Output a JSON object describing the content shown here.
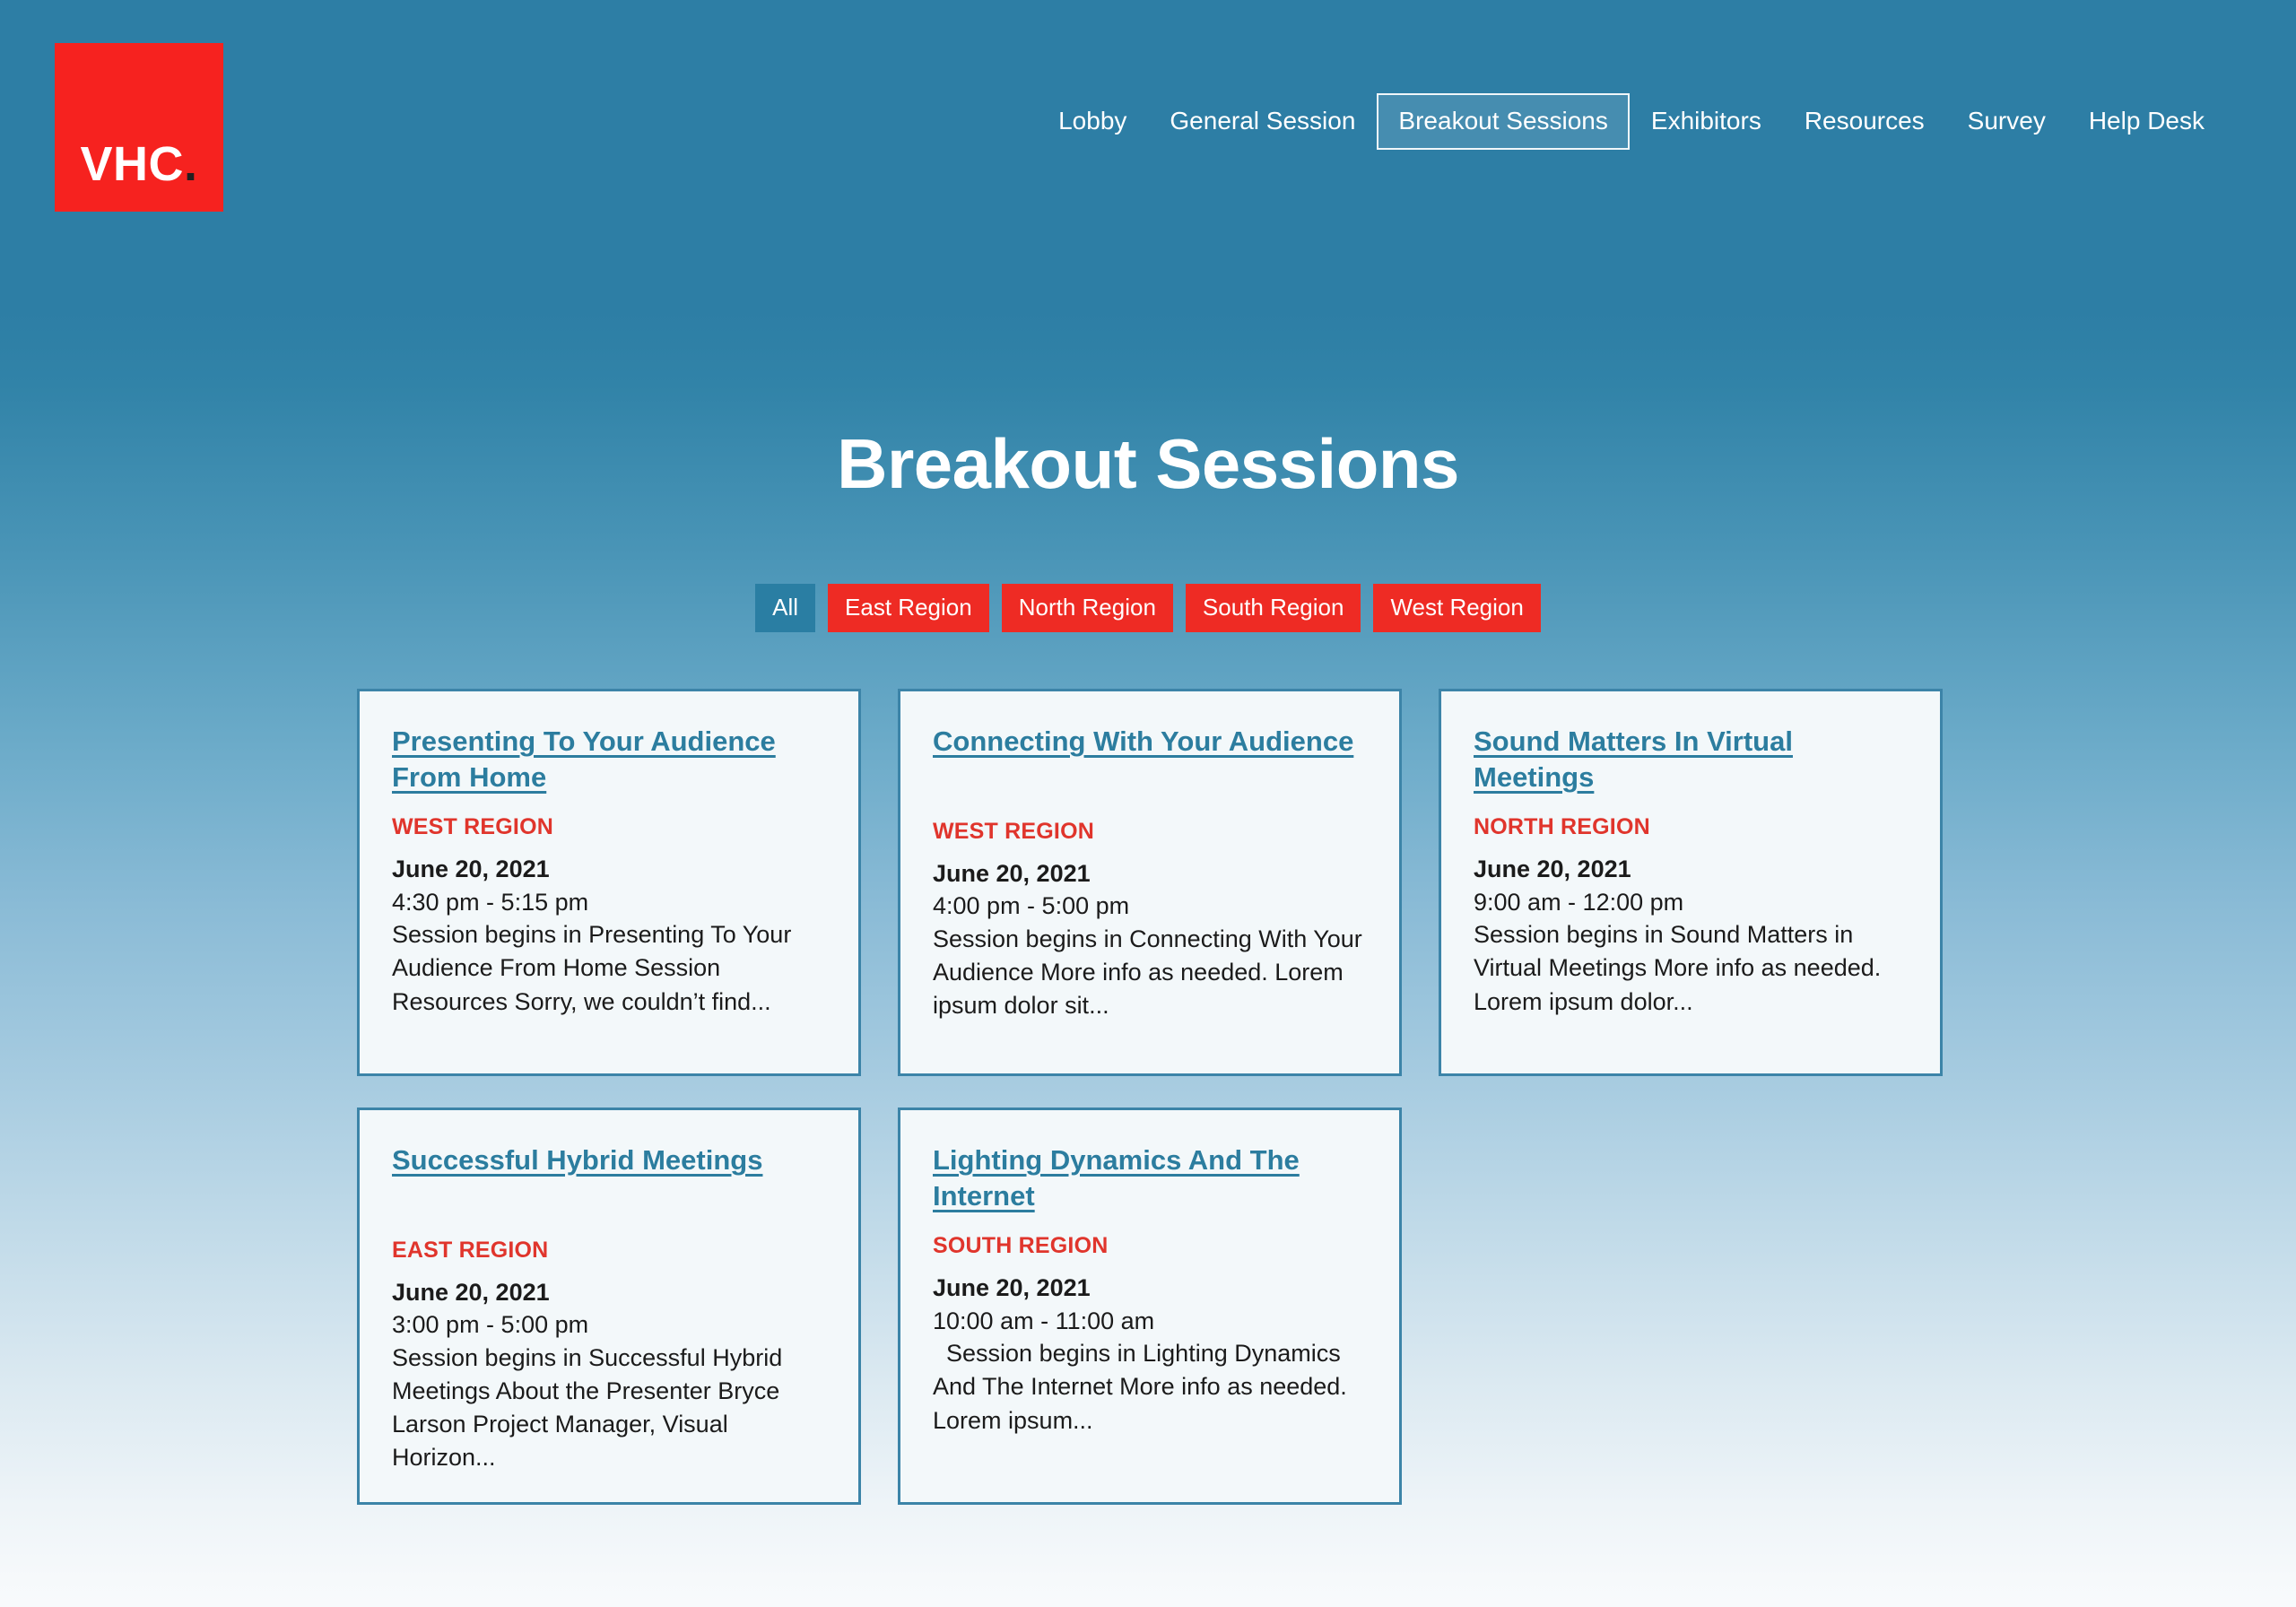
{
  "brand": {
    "logo_text": "VHC",
    "logo_dot": ".",
    "logo_bg": "#f6221f"
  },
  "nav": {
    "items": [
      {
        "label": "Lobby",
        "active": false
      },
      {
        "label": "General Session",
        "active": false
      },
      {
        "label": "Breakout Sessions",
        "active": true
      },
      {
        "label": "Exhibitors",
        "active": false
      },
      {
        "label": "Resources",
        "active": false
      },
      {
        "label": "Survey",
        "active": false
      },
      {
        "label": "Help Desk",
        "active": false
      }
    ]
  },
  "page": {
    "title": "Breakout Sessions"
  },
  "filters": {
    "items": [
      {
        "label": "All",
        "active": true
      },
      {
        "label": "East Region",
        "active": false
      },
      {
        "label": "North Region",
        "active": false
      },
      {
        "label": "South Region",
        "active": false
      },
      {
        "label": "West Region",
        "active": false
      }
    ]
  },
  "colors": {
    "accent_red": "#ee2b24",
    "region_red": "#e0352c",
    "teal": "#2d7ea5",
    "card_border": "#3c84a8",
    "link_teal": "#2c7d9f",
    "card_bg": "#f3f8fa"
  },
  "sessions": [
    {
      "title": "Presenting To Your Audience From Home",
      "region": "WEST REGION",
      "date": "June 20, 2021",
      "time": "4:30 pm - 5:15 pm",
      "description": "Session begins in Presenting To Your Audience From Home Session Resources Sorry, we couldn’t find...",
      "single_line_title": false
    },
    {
      "title": "Connecting With Your Audience",
      "region": "WEST REGION",
      "date": "June 20, 2021",
      "time": "4:00 pm - 5:00 pm",
      "description": "Session begins in Connecting With Your Audience More info as needed. Lorem ipsum dolor sit...",
      "single_line_title": true
    },
    {
      "title": "Sound Matters In Virtual Meetings",
      "region": "NORTH REGION",
      "date": "June 20, 2021",
      "time": "9:00 am - 12:00 pm",
      "description": "Session begins in Sound Matters in Virtual Meetings More info as needed. Lorem ipsum dolor...",
      "single_line_title": false
    },
    {
      "title": "Successful Hybrid Meetings",
      "region": "EAST REGION",
      "date": "June 20, 2021",
      "time": "3:00 pm - 5:00 pm",
      "description": "Session begins in Successful Hybrid Meetings About the Presenter Bryce Larson Project Manager, Visual Horizon...",
      "single_line_title": true
    },
    {
      "title": "Lighting Dynamics And The Internet",
      "region": "SOUTH REGION",
      "date": "June 20, 2021",
      "time": "10:00 am - 11:00 am",
      "description": "  Session begins in Lighting Dynamics And The Internet More info as needed. Lorem ipsum...",
      "single_line_title": false
    }
  ]
}
